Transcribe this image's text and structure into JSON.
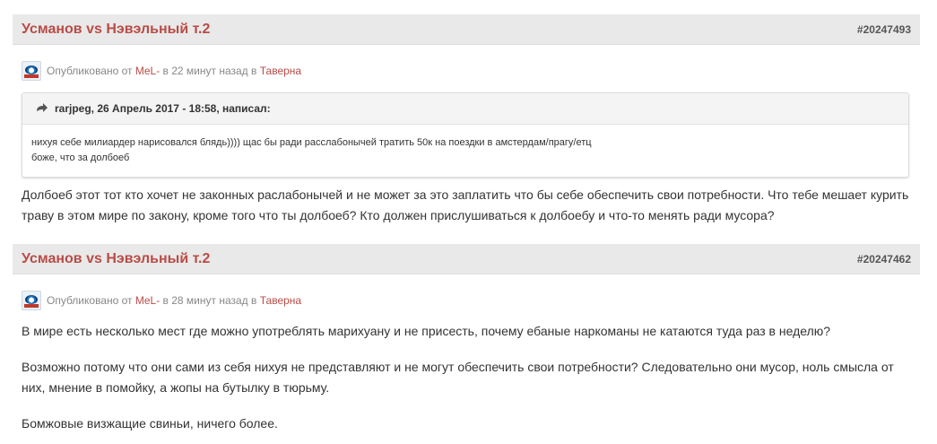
{
  "posts": [
    {
      "title": "Усманов vs Нэвэльный т.2",
      "id": "#20247493",
      "meta": {
        "prefix": "Опубликовано от ",
        "author": "MeL-",
        "time": " в 22 минут назад в ",
        "forum": "Таверна"
      },
      "quote": {
        "header": "rarjpeg, 26 Апрель 2017 - 18:58, написал:",
        "lines": [
          "нихуя себе милиардер нарисовался блядь)))) щас бы ради расслабонычей тратить 50к на поездки в амстердам/прагу/етц",
          "боже, что за долбоеб"
        ]
      },
      "body": [
        "Долбоеб этот тот кто хочет не законных раслабонычей и не может за это заплатить что  бы себе обеспечить свои потребности. Что тебе мешает курить траву в этом мире  по закону, кроме того что ты долбоеб? Кто должен прислушиваться к долбоебу и что-то менять ради мусора?"
      ]
    },
    {
      "title": "Усманов vs Нэвэльный т.2",
      "id": "#20247462",
      "meta": {
        "prefix": "Опубликовано от ",
        "author": "MeL-",
        "time": " в 28 минут назад в ",
        "forum": "Таверна"
      },
      "body": [
        "В мире есть несколько мест где можно употреблять марихуану и не присесть, почему ебаные наркоманы не катаются туда раз в неделю?",
        "Возможно потому что они сами из себя нихуя  не представляют и не могут обеспечить свои потребности? Следовательно они мусор, ноль смысла от них, мнение в помойку, а жопы на бутылку в тюрьму.",
        "Бомжовые визжащие свиньи, ничего более."
      ]
    }
  ],
  "colors": {
    "title": "#b94c47",
    "header_bg": "#e9e9e9",
    "link": "#b94c47"
  },
  "icons": {
    "avatar": "avatar-icon",
    "quote": "quote-arrow-icon"
  }
}
